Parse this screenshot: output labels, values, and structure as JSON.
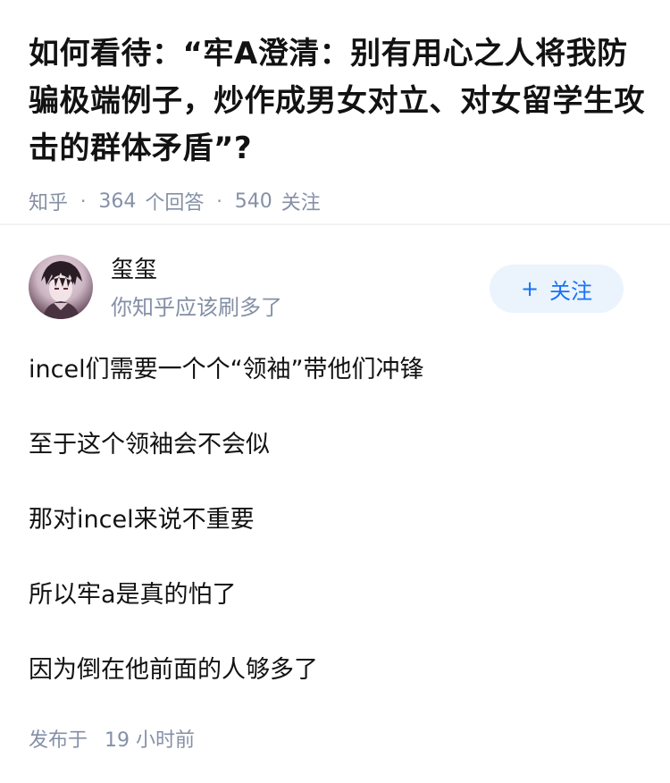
{
  "question": {
    "title": "如何看待：“牢A澄清：别有用心之人将我防骗极端例子，炒作成男女对立、对女留学生攻击的群体矛盾”?",
    "source": "知乎",
    "separator": "·",
    "answer_count": "364",
    "answer_label": "个回答",
    "follower_count": "540",
    "follower_label": "关注"
  },
  "answer": {
    "author": {
      "name": "玺玺",
      "headline": "你知乎应该刷多了",
      "avatar_icon": "anime-avatar"
    },
    "follow_button": {
      "icon": "+",
      "label": "关注",
      "color": "#1772f6",
      "background": "#ebf4fd"
    },
    "paragraphs": [
      "incel们需要一个个“领袖”带他们冲锋",
      "至于这个领袖会不会似",
      "那对incel来说不重要",
      "所以牢a是真的怕了",
      "因为倒在他前面的人够多了"
    ],
    "time_prefix": "发布于",
    "time_value": "19 小时前"
  }
}
